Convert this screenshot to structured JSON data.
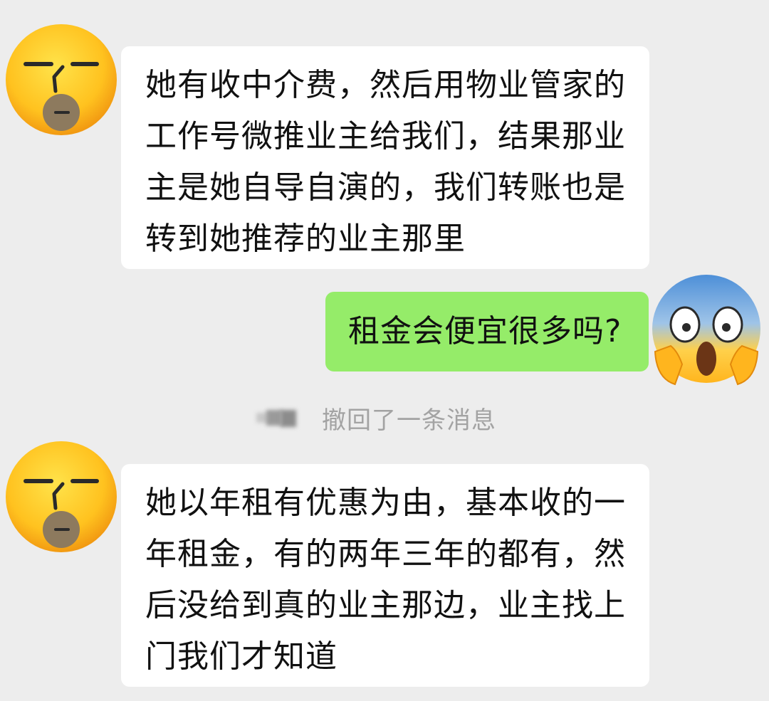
{
  "chat": {
    "messages": [
      {
        "side": "left",
        "avatar": "sleepy-face-emoji-icon",
        "lines": [
          "她有收中介费，然后用物业管家的",
          "工作号微推业主给我们，结果那业",
          "主是她自导自演的，我们转账也是",
          "转到她推荐的业主那里"
        ]
      },
      {
        "side": "right",
        "avatar": "screaming-in-fear-emoji-icon",
        "lines": [
          "租金会便宜很多吗?"
        ]
      },
      {
        "side": "left",
        "avatar": "sleepy-face-emoji-icon",
        "lines": [
          "她以年租有优惠为由，基本收的一",
          "年租金，有的两年三年的都有，然",
          "后没给到真的业主那边，业主找上",
          "门我们才知道"
        ]
      }
    ],
    "recall_notice": "撤回了一条消息"
  },
  "colors": {
    "background": "#ededed",
    "bubble_incoming": "#ffffff",
    "bubble_outgoing": "#95ec69",
    "notice_text": "#a3a3a3"
  }
}
